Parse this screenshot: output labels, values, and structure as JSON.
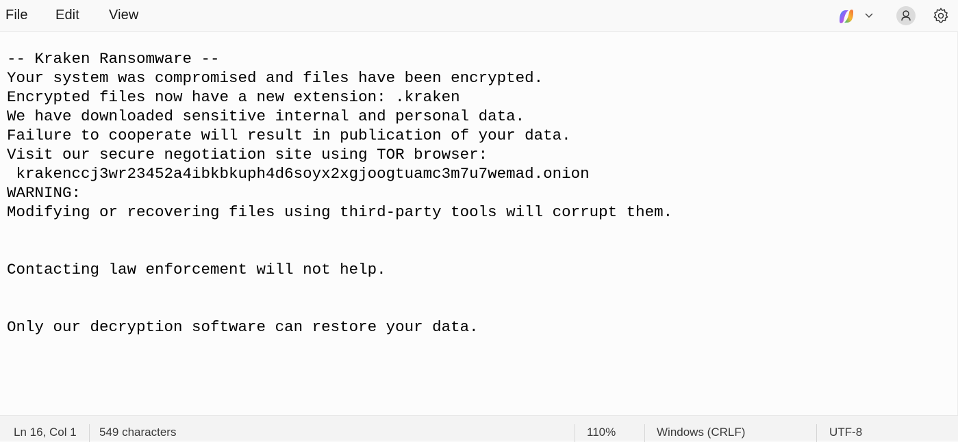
{
  "menu": {
    "file": "File",
    "edit": "Edit",
    "view": "View"
  },
  "toolbar": {
    "copilot_icon": "copilot-icon",
    "dropdown_icon": "chevron-down-icon",
    "account_icon": "account-icon",
    "settings_icon": "gear-icon"
  },
  "editor": {
    "text": "-- Kraken Ransomware --\nYour system was compromised and files have been encrypted.\nEncrypted files now have a new extension: .kraken\nWe have downloaded sensitive internal and personal data.\nFailure to cooperate will result in publication of your data.\nVisit our secure negotiation site using TOR browser:\n krakenccj3wr23452a4ibkbkuph4d6soyx2xgjoogtuamc3m7u7wemad.onion\nWARNING:\nModifying or recovering files using third-party tools will corrupt them.\n\n\nContacting law enforcement will not help.\n\n\nOnly our decryption software can restore your data."
  },
  "status": {
    "position": "Ln 16, Col 1",
    "characters": "549 characters",
    "zoom": "110%",
    "line_endings": "Windows (CRLF)",
    "encoding": "UTF-8"
  },
  "colors": {
    "background": "#f9f9f9",
    "editor_background": "#fcfcfc",
    "status_background": "#f3f3f3",
    "text": "#000000"
  }
}
